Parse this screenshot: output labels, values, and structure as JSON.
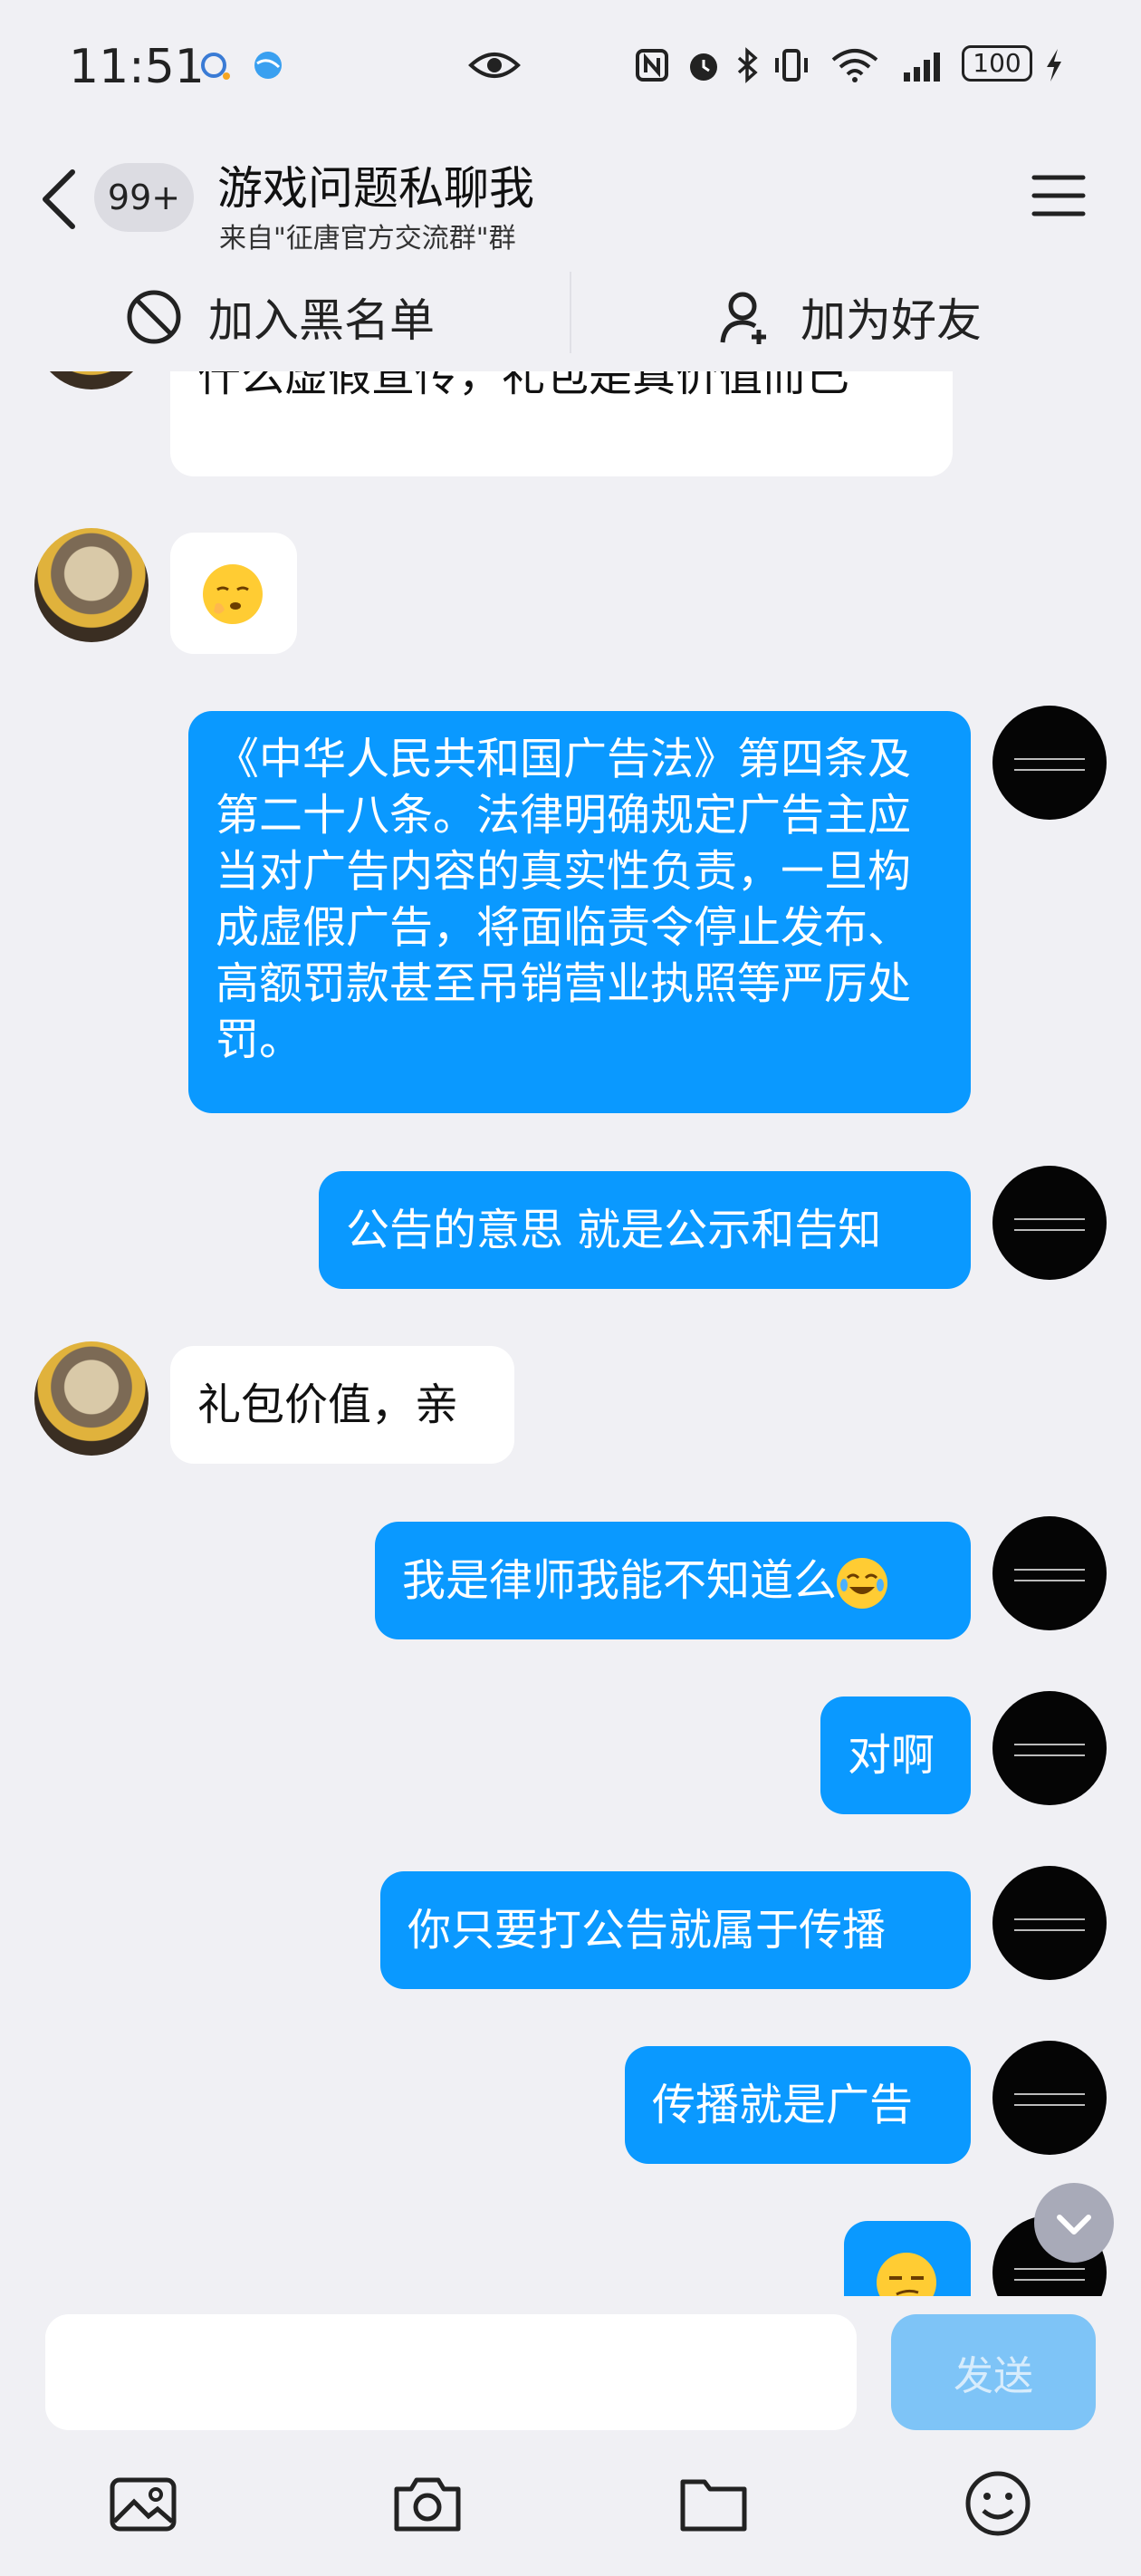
{
  "status_bar": {
    "time": "11:51",
    "battery": "100"
  },
  "title_bar": {
    "unread_badge": "99+",
    "title": "游戏问题私聊我",
    "subtitle": "来自\"征唐官方交流群\"群"
  },
  "actions": {
    "blacklist_label": "加入黑名单",
    "add_friend_label": "加为好友"
  },
  "messages": [
    {
      "side": "in",
      "text": "什么虚假宣传，礼包是真价值而已"
    },
    {
      "side": "in",
      "emoji": "sleepy-face"
    },
    {
      "side": "out",
      "text": "《中华人民共和国广告法》第四条及第二十八条。法律明确规定广告主应当对广告内容的真实性负责，一旦构成虚假广告，将面临责令停止发布、高额罚款甚至吊销营业执照等严厉处罚。"
    },
    {
      "side": "out",
      "text": "公告的意思 就是公示和告知"
    },
    {
      "side": "in",
      "text": "礼包价值，亲"
    },
    {
      "side": "out",
      "text": "我是律师我能不知道么",
      "emoji": "laughing-face"
    },
    {
      "side": "out",
      "text": "对啊"
    },
    {
      "side": "out",
      "text": "你只要打公告就属于传播"
    },
    {
      "side": "out",
      "text": "传播就是广告"
    },
    {
      "side": "out",
      "emoji": "smirk-face"
    }
  ],
  "input": {
    "value": "",
    "send_label": "发送"
  },
  "icons": {
    "colors": {
      "accent": "#0a99ff",
      "send_disabled": "#7ec4f7",
      "background": "#f0f0f4"
    }
  }
}
